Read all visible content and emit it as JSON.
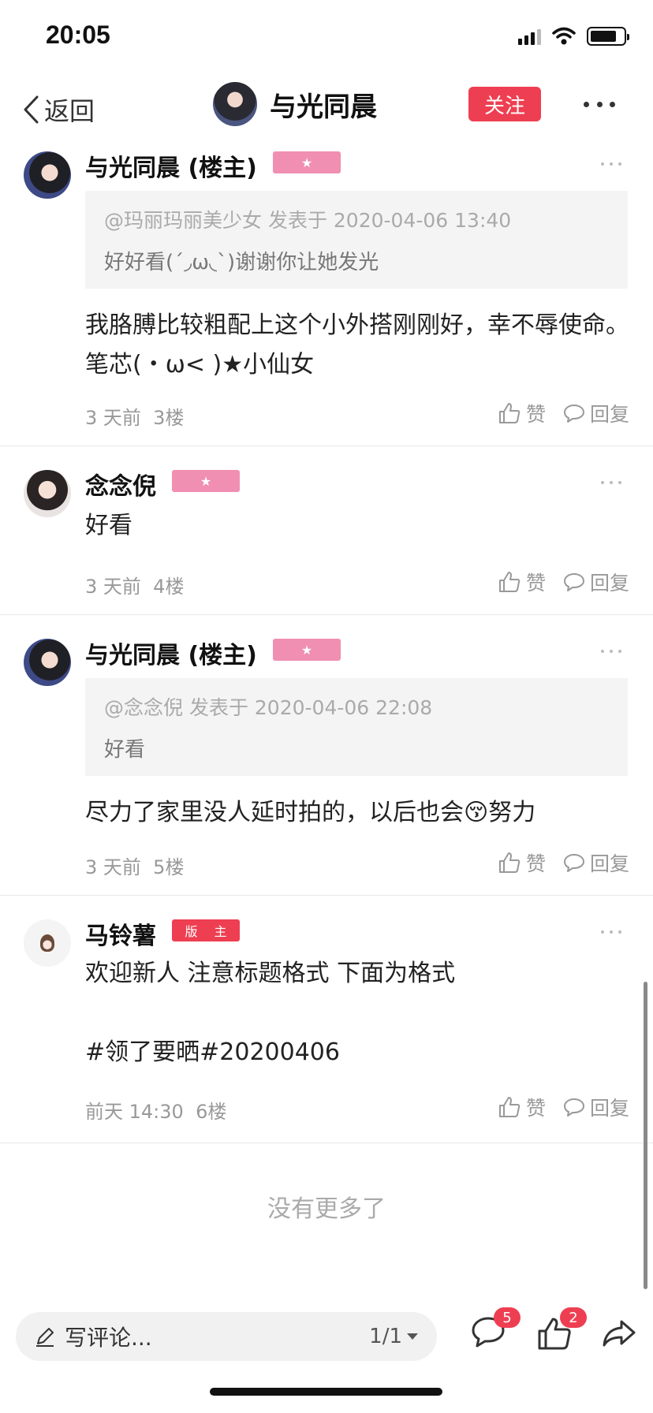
{
  "status": {
    "time": "20:05"
  },
  "nav": {
    "back_label": "返回",
    "title": "与光同晨",
    "follow_label": "关注"
  },
  "posts": [
    {
      "user": "与光同晨 (楼主)",
      "badge": "★",
      "quote_head": "@玛丽玛丽美少女 发表于 2020-04-06 13:40",
      "quote_body": "好好看(´◞ω◟`)谢谢你让她发光",
      "content": "我胳膊比较粗配上这个小外搭刚刚好，幸不辱使命。笔芯(・ω< )★小仙女",
      "time": "3 天前",
      "floor": "3楼"
    },
    {
      "user": "念念倪",
      "badge": "★",
      "content": "好看",
      "time": "3 天前",
      "floor": "4楼"
    },
    {
      "user": "与光同晨 (楼主)",
      "badge": "★",
      "quote_head": "@念念倪 发表于 2020-04-06 22:08",
      "quote_body": "好看",
      "content": "尽力了家里没人延时拍的，以后也会😚努力",
      "time": "3 天前",
      "floor": "5楼"
    },
    {
      "user": "马铃薯",
      "badge": "版 主",
      "content": "欢迎新人 注意标题格式 下面为格式\n\n#领了要晒#20200406",
      "time": "前天 14:30",
      "floor": "6楼"
    }
  ],
  "actions": {
    "like_label": "赞",
    "reply_label": "回复"
  },
  "footer": {
    "no_more": "没有更多了"
  },
  "bottom": {
    "placeholder": "写评论...",
    "page": "1/1",
    "comment_count": "5",
    "like_count": "2"
  },
  "colors": {
    "accent": "#ee3f52",
    "star_badge": "#f08fb2"
  }
}
